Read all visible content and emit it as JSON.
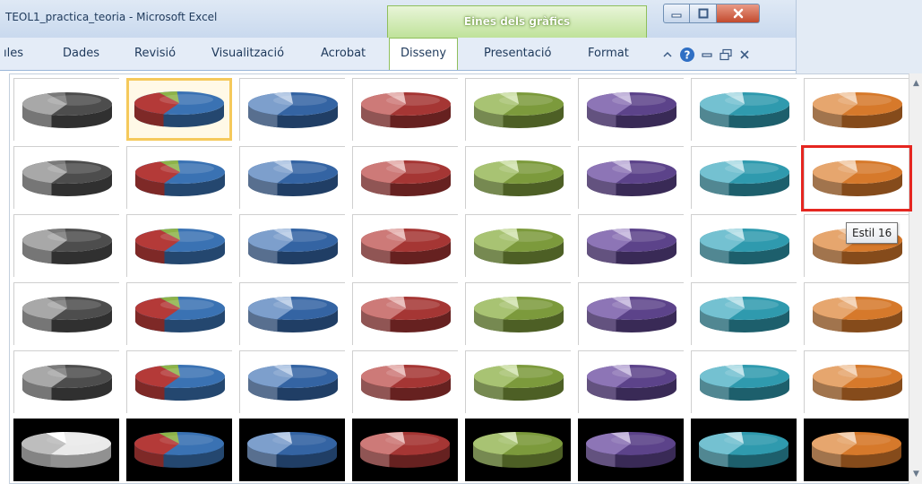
{
  "window": {
    "title": "TEOL1_practica_teoria - Microsoft Excel"
  },
  "contextual_tab_group": {
    "label": "Eines dels gràfics"
  },
  "ribbon": {
    "tabs": [
      {
        "label": "ıles"
      },
      {
        "label": "Dades"
      },
      {
        "label": "Revisió"
      },
      {
        "label": "Visualització"
      },
      {
        "label": "Acrobat"
      },
      {
        "label": "Disseny",
        "active": true
      },
      {
        "label": "Presentació"
      },
      {
        "label": "Format"
      }
    ]
  },
  "gallery": {
    "rows": 6,
    "columns": 8,
    "column_colors": [
      {
        "main": "#4d4d4d",
        "slice1": "#a8a8a8",
        "slice2": "#7a7a7a"
      },
      {
        "main": "#3a72b3",
        "slice1": "#b43a38",
        "slice2": "#8db348"
      },
      {
        "main": "#3464a3",
        "slice1": "#7d9fcc",
        "slice2": "#b7cbe6"
      },
      {
        "main": "#a53634",
        "slice1": "#cd7a78",
        "slice2": "#e7b6b4"
      },
      {
        "main": "#7c9a3c",
        "slice1": "#a8c373",
        "slice2": "#d2e3b0"
      },
      {
        "main": "#5c438a",
        "slice1": "#8d75b6",
        "slice2": "#c4b6dc"
      },
      {
        "main": "#2f9aae",
        "slice1": "#74c1d1",
        "slice2": "#b7e0e8"
      },
      {
        "main": "#d6792b",
        "slice1": "#e6a66e",
        "slice2": "#f3d0b0"
      }
    ],
    "dark_background_row": 6,
    "selected_style": {
      "row": 1,
      "column": 2
    },
    "highlighted_style": {
      "row": 2,
      "column": 8
    }
  },
  "tooltip": {
    "text": "Estil 16"
  }
}
